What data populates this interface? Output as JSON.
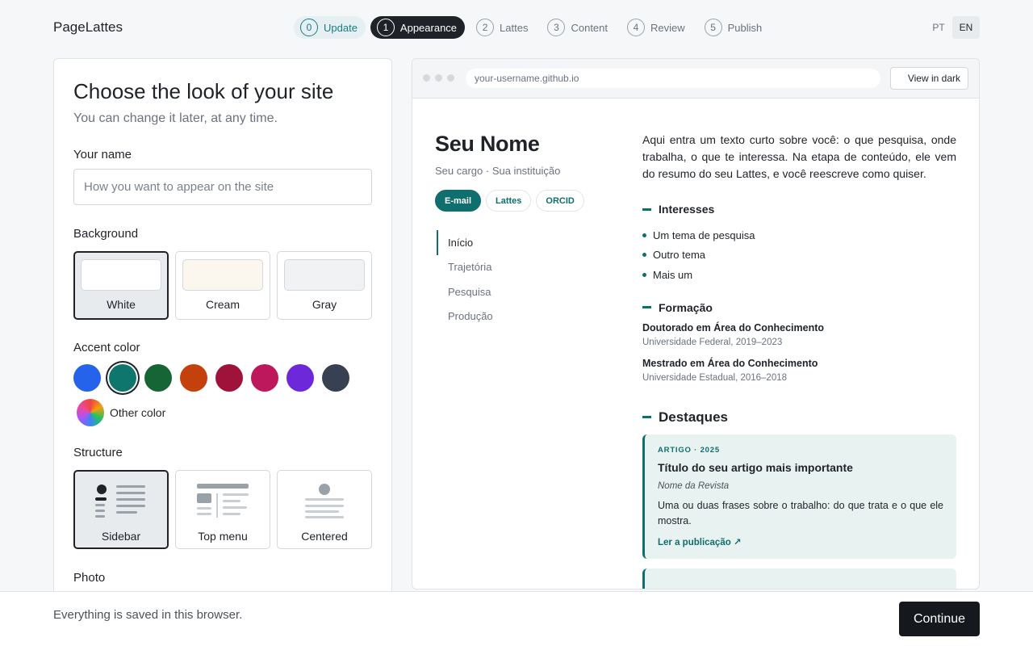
{
  "app": {
    "brand": "PageLattes"
  },
  "steps": [
    {
      "num": "0",
      "label": "Update"
    },
    {
      "num": "1",
      "label": "Appearance"
    },
    {
      "num": "2",
      "label": "Lattes"
    },
    {
      "num": "3",
      "label": "Content"
    },
    {
      "num": "4",
      "label": "Review"
    },
    {
      "num": "5",
      "label": "Publish"
    }
  ],
  "languages": [
    "PT",
    "EN"
  ],
  "form": {
    "title": "Choose the look of your site",
    "subtitle": "You can change it later, at any time.",
    "name_label": "Your name",
    "name_placeholder": "How you want to appear on the site",
    "background_label": "Background",
    "backgrounds": [
      {
        "label": "White",
        "color": "#ffffff"
      },
      {
        "label": "Cream",
        "color": "#fbf6ee"
      },
      {
        "label": "Gray",
        "color": "#f0f2f4"
      }
    ],
    "accent_label": "Accent color",
    "accent_colors": [
      "#2563eb",
      "#0f766e",
      "#166534",
      "#c2410c",
      "#9f1239",
      "#be185d",
      "#6d28d9",
      "#374151"
    ],
    "other_color_label": "Other color",
    "structure_label": "Structure",
    "structures": [
      {
        "label": "Sidebar",
        "icon": "sidebar-layout-icon"
      },
      {
        "label": "Top menu",
        "icon": "top-menu-layout-icon"
      },
      {
        "label": "Centered",
        "icon": "centered-layout-icon"
      }
    ],
    "photo_label": "Photo"
  },
  "preview": {
    "url": "your-username.github.io",
    "dark_button": "View in dark",
    "dark_icon": "moon-icon",
    "name": "Seu Nome",
    "role": "Seu cargo · Sua instituição",
    "chips": [
      "E-mail",
      "Lattes",
      "ORCID"
    ],
    "nav": [
      "Início",
      "Trajetória",
      "Pesquisa",
      "Produção"
    ],
    "intro": "Aqui entra um texto curto sobre você: o que pesquisa, onde tra­balha, o que te interessa. Na etapa de conteúdo, ele vem do re­sumo do seu Lattes, e você reescreve como quiser.",
    "interests_title": "Interesses",
    "interests": [
      "Um tema de pesquisa",
      "Outro tema",
      "Mais um"
    ],
    "education_title": "Formação",
    "education": [
      {
        "degree": "Doutorado em Área do Conhecimento",
        "inst": "Universidade Federal, 2019–2023"
      },
      {
        "degree": "Mestrado em Área do Conhecimento",
        "inst": "Universidade Estadual, 2016–2018"
      }
    ],
    "highlights_title": "Destaques",
    "highlight": {
      "meta": "ARTIGO · 2025",
      "title": "Título do seu artigo mais importante",
      "journal": "Nome da Revista",
      "desc": "Uma ou duas frases sobre o trabalho: do que trata e o que ele mostra.",
      "link": "Ler a publicação ↗"
    }
  },
  "footer": {
    "note": "Everything is saved in this browser.",
    "continue": "Continue"
  }
}
